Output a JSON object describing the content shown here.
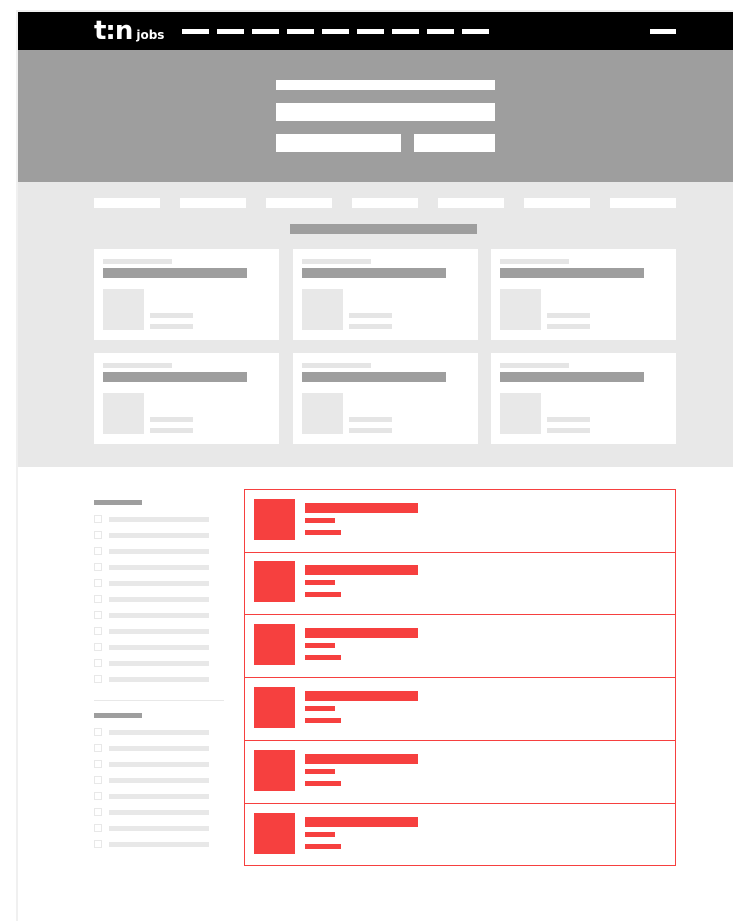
{
  "header": {
    "logo_mark": "t:n",
    "logo_sub": "jobs",
    "nav_links": [
      "",
      "",
      "",
      "",
      "",
      "",
      "",
      "",
      ""
    ],
    "menu_label": ""
  },
  "colors": {
    "nav_bg": "#000000",
    "hero_bg": "#9e9e9e",
    "category_bg": "#e8e8e8",
    "accent": "#f6403f",
    "placeholder_dark": "#9e9e9e",
    "placeholder_light": "#e8e8e8"
  },
  "hero": {
    "title": "",
    "search_placeholder": "",
    "location_placeholder": "",
    "search_button": ""
  },
  "categories": {
    "tabs": [
      "",
      "",
      "",
      "",
      "",
      "",
      ""
    ],
    "section_title": "",
    "cards": [
      {
        "label": "",
        "title": "",
        "meta1": "",
        "meta2": ""
      },
      {
        "label": "",
        "title": "",
        "meta1": "",
        "meta2": ""
      },
      {
        "label": "",
        "title": "",
        "meta1": "",
        "meta2": ""
      },
      {
        "label": "",
        "title": "",
        "meta1": "",
        "meta2": ""
      },
      {
        "label": "",
        "title": "",
        "meta1": "",
        "meta2": ""
      },
      {
        "label": "",
        "title": "",
        "meta1": "",
        "meta2": ""
      }
    ]
  },
  "filters": {
    "groups": [
      {
        "title": "",
        "options": [
          "",
          "",
          "",
          "",
          "",
          "",
          "",
          "",
          "",
          "",
          ""
        ]
      },
      {
        "title": "",
        "options": [
          "",
          "",
          "",
          "",
          "",
          "",
          "",
          ""
        ]
      }
    ]
  },
  "jobs": [
    {
      "title": "",
      "company": "",
      "location": ""
    },
    {
      "title": "",
      "company": "",
      "location": ""
    },
    {
      "title": "",
      "company": "",
      "location": ""
    },
    {
      "title": "",
      "company": "",
      "location": ""
    },
    {
      "title": "",
      "company": "",
      "location": ""
    },
    {
      "title": "",
      "company": "",
      "location": ""
    }
  ]
}
